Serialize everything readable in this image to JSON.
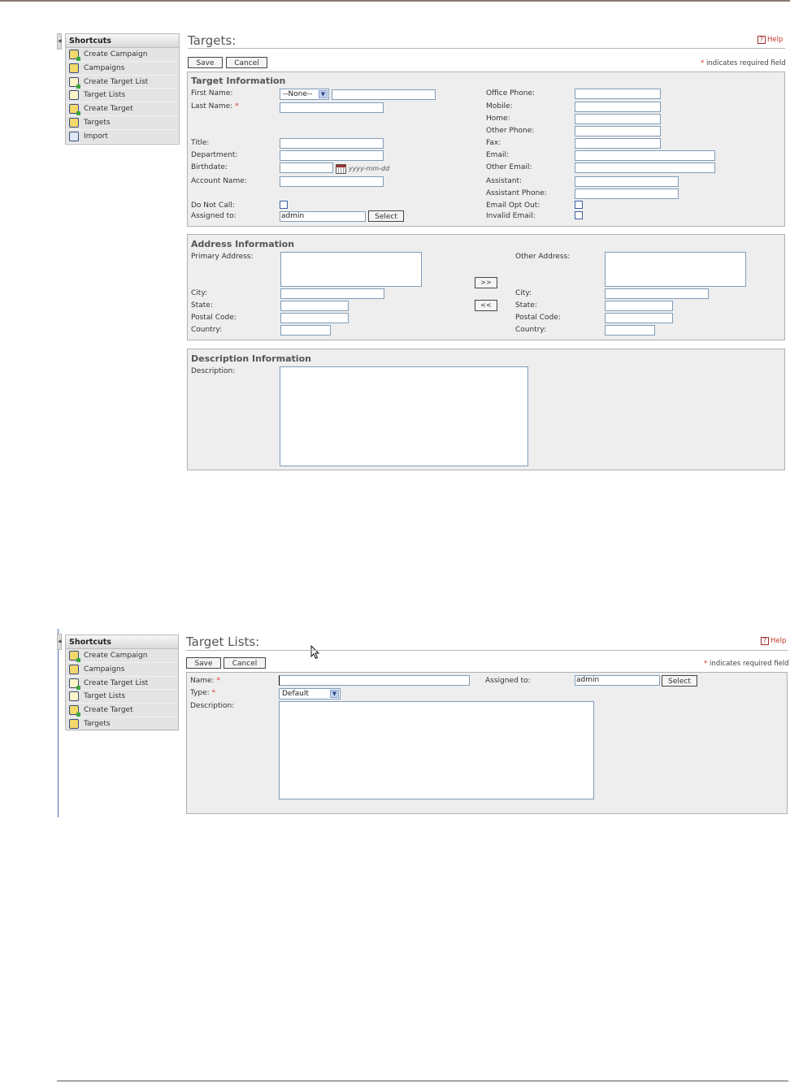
{
  "shortcuts": {
    "title": "Shortcuts",
    "items_top": [
      {
        "label": "Create Campaign",
        "icon": "create-campaign-icon"
      },
      {
        "label": "Campaigns",
        "icon": "campaigns-icon"
      },
      {
        "label": "Create Target List",
        "icon": "create-target-list-icon"
      },
      {
        "label": "Target Lists",
        "icon": "target-lists-icon"
      },
      {
        "label": "Create Target",
        "icon": "create-target-icon"
      },
      {
        "label": "Targets",
        "icon": "targets-icon"
      },
      {
        "label": "Import",
        "icon": "import-icon"
      }
    ],
    "items_bottom": [
      {
        "label": "Create Campaign",
        "icon": "create-campaign-icon"
      },
      {
        "label": "Campaigns",
        "icon": "campaigns-icon"
      },
      {
        "label": "Create Target List",
        "icon": "create-target-list-icon"
      },
      {
        "label": "Target Lists",
        "icon": "target-lists-icon"
      },
      {
        "label": "Create Target",
        "icon": "create-target-icon"
      },
      {
        "label": "Targets",
        "icon": "targets-icon"
      }
    ]
  },
  "common": {
    "help": "Help",
    "required_star": "*",
    "required_note": "indicates required field",
    "save": "Save",
    "cancel": "Cancel",
    "select": "Select"
  },
  "targets_form": {
    "title": "Targets:",
    "target_info": {
      "title": "Target Information",
      "first_name": "First Name:",
      "salutation": "--None--",
      "last_name": "Last Name:",
      "title_label": "Title:",
      "department": "Department:",
      "birthdate": "Birthdate:",
      "date_format": "yyyy-mm-dd",
      "account_name": "Account Name:",
      "do_not_call": "Do Not Call:",
      "assigned_to": "Assigned to:",
      "assigned_value": "admin",
      "office_phone": "Office Phone:",
      "mobile": "Mobile:",
      "home": "Home:",
      "other_phone": "Other Phone:",
      "fax": "Fax:",
      "email": "Email:",
      "other_email": "Other Email:",
      "assistant": "Assistant:",
      "assistant_phone": "Assistant Phone:",
      "email_opt_out": "Email Opt Out:",
      "invalid_email": "Invalid Email:"
    },
    "address_info": {
      "title": "Address Information",
      "primary_address": "Primary Address:",
      "other_address": "Other Address:",
      "city": "City:",
      "state": "State:",
      "postal_code": "Postal Code:",
      "country": "Country:",
      "copy_right": ">>",
      "copy_left": "<<"
    },
    "description_info": {
      "title": "Description Information",
      "description": "Description:"
    }
  },
  "target_lists_form": {
    "title": "Target Lists:",
    "name": "Name:",
    "type": "Type:",
    "type_value": "Default",
    "description": "Description:",
    "assigned_to": "Assigned to:",
    "assigned_value": "admin"
  }
}
